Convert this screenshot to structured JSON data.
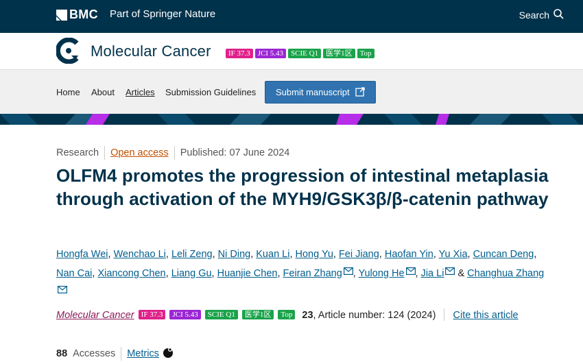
{
  "topbar": {
    "brand": "BMC",
    "part_of": "Part of Springer Nature",
    "search_label": "Search",
    "logo_icon": "bmc-square-logo-icon",
    "search_icon": "search-icon"
  },
  "journal": {
    "title": "Molecular Cancer",
    "logo_icon": "molecular-cancer-logo-icon",
    "badges": [
      {
        "label": "IF 37.3",
        "color": "#e0218a"
      },
      {
        "label": "JCI 5.43",
        "color": "#9b27d4"
      },
      {
        "label": "SCIE Q1",
        "color": "#1aa34a"
      },
      {
        "label": "医学1区",
        "color": "#1aa34a"
      },
      {
        "label": "Top",
        "color": "#1aa34a"
      }
    ]
  },
  "nav": {
    "items": [
      "Home",
      "About",
      "Articles",
      "Submission Guidelines"
    ],
    "active": "Articles",
    "submit_label": "Submit manuscript",
    "submit_icon": "external-link-icon"
  },
  "article": {
    "type": "Research",
    "access": "Open access",
    "published": "Published: 07 June 2024",
    "title": "OLFM4 promotes the progression of intestinal metaplasia through activation of the MYH9/GSK3β/β-catenin pathway",
    "authors": [
      "Hongfa Wei",
      "Wenchao Li",
      "Leli Zeng",
      "Ni Ding",
      "Kuan Li",
      "Hong Yu",
      "Fei Jiang",
      "Haofan Yin",
      "Yu Xia",
      "Cuncan Deng",
      "Nan Cai",
      "Xiancong Chen",
      "Liang Gu",
      "Huanjie Chen",
      "Feiran Zhang",
      "Yulong He",
      "Jia Li",
      "Changhua Zhang"
    ],
    "authors_and": "&",
    "citation": {
      "journal": "Molecular Cancer",
      "volume": "23",
      "article_number": ", Article number: 124 (2024)",
      "cite_this": "Cite this article"
    },
    "metrics": {
      "accesses_count": "88",
      "accesses_label": "Accesses",
      "metrics_link": "Metrics"
    }
  },
  "colors": {
    "navy": "#01324b",
    "link": "#025e8d",
    "submit": "#3073b0",
    "open_access": "#c05000",
    "journal_link": "#8b1a5b"
  }
}
